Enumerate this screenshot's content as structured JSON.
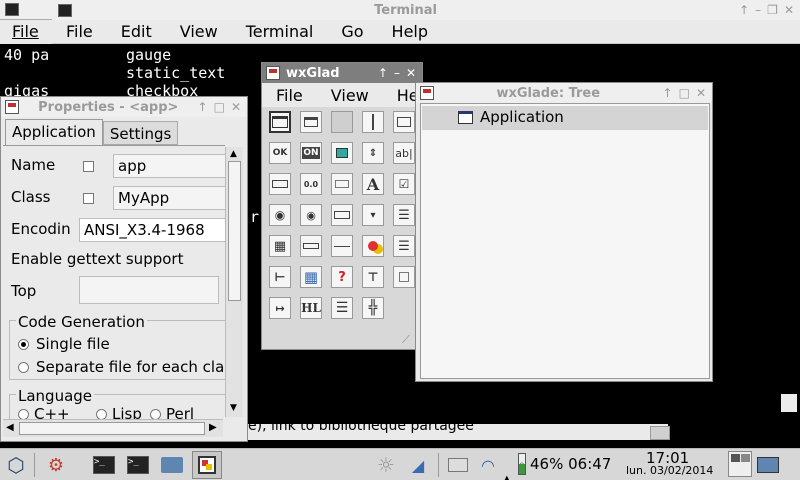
{
  "terminal_bg": {
    "menu": "File",
    "lines": [
      "40 pa",
      "gigas"
    ]
  },
  "terminal": {
    "title": "Terminal",
    "menu": [
      "File",
      "Edit",
      "View",
      "Terminal",
      "Go",
      "Help"
    ],
    "lines": [
      "gauge",
      "static_text",
      "checkbox"
    ],
    "fragment": "r",
    "bottom_text": "e), link to bibliothèque partagée"
  },
  "wxglade": {
    "title": "wxGlad",
    "menu": [
      "File",
      "View",
      "Help"
    ],
    "palette": [
      "frame",
      "dialog",
      "panel",
      "splitter",
      "notebook",
      "ok-button",
      "toggle-button",
      "bitmap-button",
      "spin-button",
      "text-ctrl",
      "combo",
      "slider",
      "static-line",
      "static-text",
      "checkbox",
      "radio",
      "radio-box",
      "choice",
      "list-box",
      "gauge",
      "grid",
      "list-ctrl",
      "line",
      "static-bitmap",
      "html",
      "tree",
      "grid2",
      "help",
      "toolbar",
      "spacer",
      "spacer2",
      "html-label",
      "box-sizer",
      "grid-sizer"
    ],
    "hl_label": "HL",
    "ok_label": "OK",
    "on_label": "ON",
    "ab_label": "ab|",
    "a_label": "A",
    "q_label": "?",
    "num_label": "0.0"
  },
  "tree": {
    "title": "wxGlade: Tree",
    "root": "Application"
  },
  "properties": {
    "title": "Properties - <app>",
    "tabs": [
      "Application",
      "Settings"
    ],
    "name_label": "Name",
    "name_value": "app",
    "class_label": "Class",
    "class_value": "MyApp",
    "encoding_label": "Encodin",
    "encoding_value": "ANSI_X3.4-1968",
    "gettext_label": "Enable gettext support",
    "top_label": "Top",
    "code_gen_label": "Code Generation",
    "single_file": "Single file",
    "separate_file": "Separate file for each cla",
    "language_label": "Language",
    "languages": [
      "C++",
      "Lisp",
      "Perl"
    ]
  },
  "taskbar": {
    "battery": "46% 06:47",
    "clock_time": "17:01",
    "clock_date": "lun. 03/02/2014",
    "battery_level": "0"
  },
  "colors": {
    "accent": "#6a8fd8",
    "title_dark": "#7e7e7e"
  }
}
